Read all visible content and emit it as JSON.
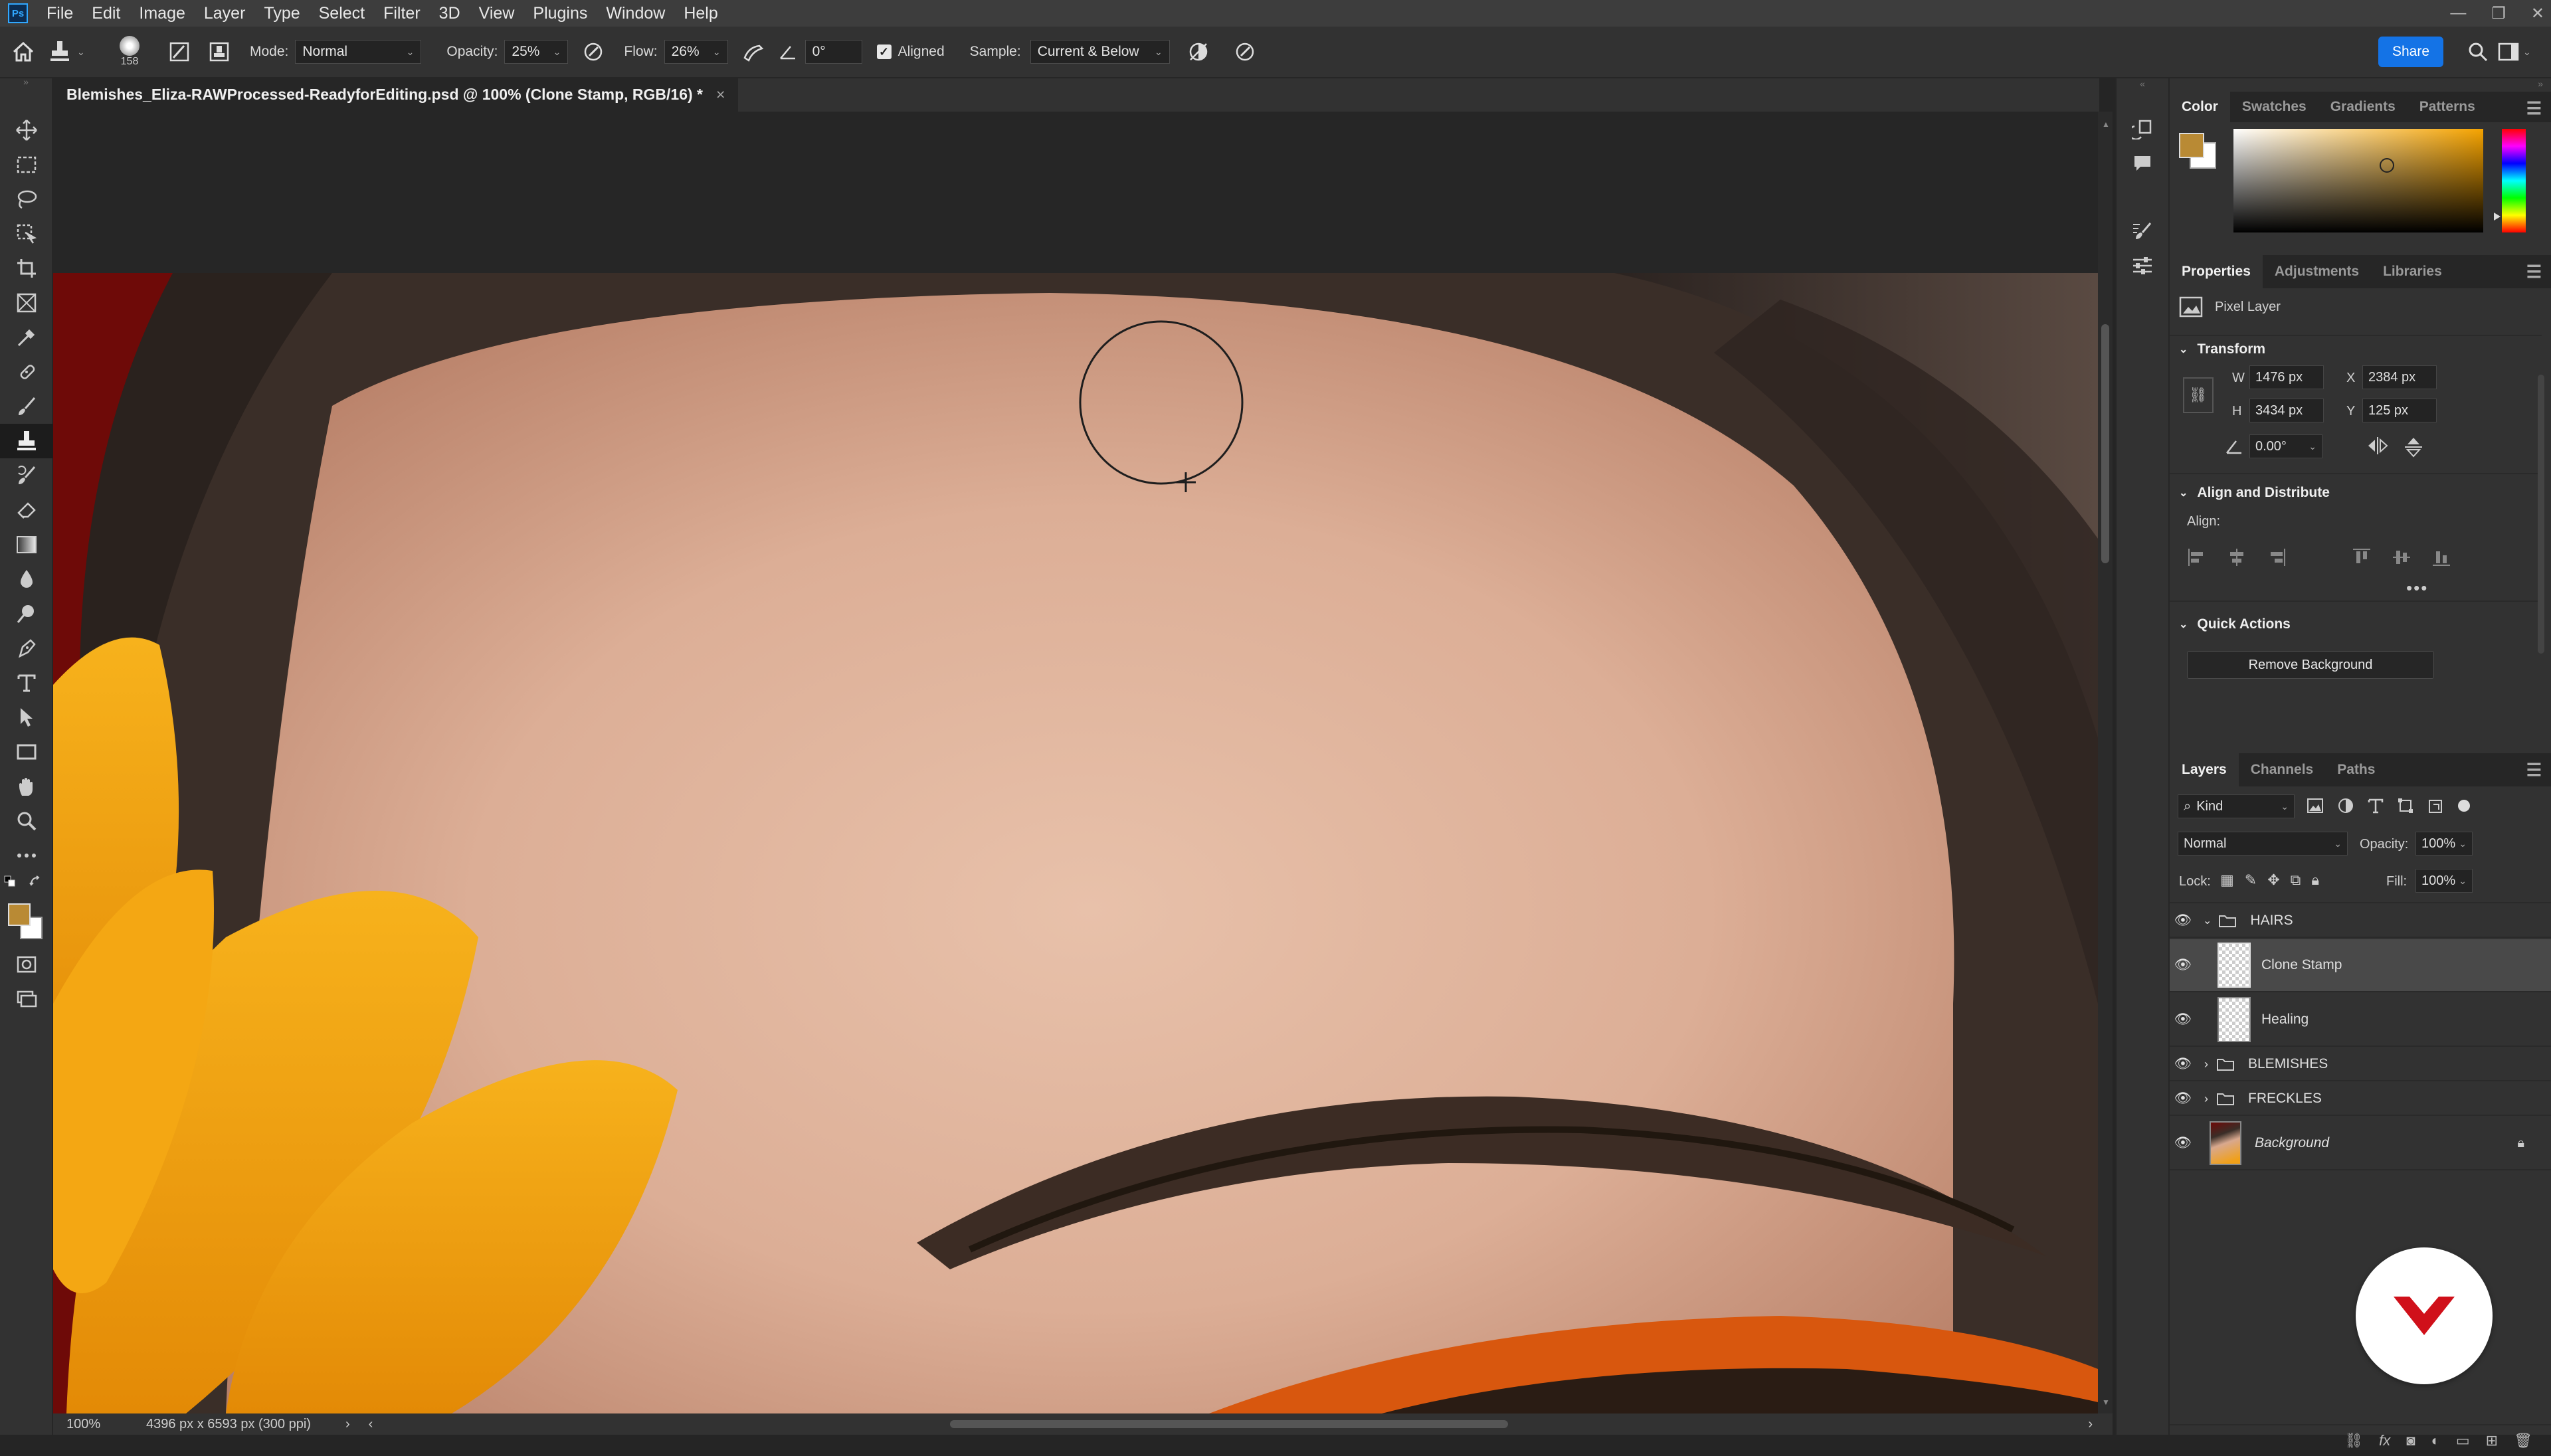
{
  "menubar": {
    "app_icon": "Ps",
    "items": [
      "File",
      "Edit",
      "Image",
      "Layer",
      "Type",
      "Select",
      "Filter",
      "3D",
      "View",
      "Plugins",
      "Window",
      "Help"
    ],
    "window_controls": [
      "minimize-icon",
      "restore-icon",
      "close-icon"
    ]
  },
  "options": {
    "brush_size": "158",
    "mode_label": "Mode:",
    "mode_value": "Normal",
    "opacity_label": "Opacity:",
    "opacity_value": "25%",
    "flow_label": "Flow:",
    "flow_value": "26%",
    "angle_value": "0°",
    "aligned_label": "Aligned",
    "aligned_checked": true,
    "sample_label": "Sample:",
    "sample_value": "Current & Below",
    "share_label": "Share"
  },
  "document": {
    "tab_title": "Blemishes_Eliza-RAWProcessed-ReadyforEditing.psd @ 100% (Clone Stamp, RGB/16) *",
    "zoom": "100%",
    "doc_info": "4396 px x 6593 px (300 ppi)"
  },
  "color_panel": {
    "tabs": [
      "Color",
      "Swatches",
      "Gradients",
      "Patterns"
    ],
    "active_tab": "Color",
    "foreground": "#b98a34",
    "background": "#ffffff",
    "picker_hue": "#f5a300"
  },
  "properties_panel": {
    "tabs": [
      "Properties",
      "Adjustments",
      "Libraries"
    ],
    "active_tab": "Properties",
    "layer_type": "Pixel Layer",
    "transform_title": "Transform",
    "w_label": "W",
    "w_value": "1476 px",
    "h_label": "H",
    "h_value": "3434 px",
    "x_label": "X",
    "x_value": "2384 px",
    "y_label": "Y",
    "y_value": "125 px",
    "angle_value": "0.00°",
    "align_title": "Align and Distribute",
    "align_label": "Align:",
    "quick_actions_title": "Quick Actions",
    "remove_bg_label": "Remove Background"
  },
  "layers_panel": {
    "tabs": [
      "Layers",
      "Channels",
      "Paths"
    ],
    "active_tab": "Layers",
    "filter_kind": "Kind",
    "blend_mode": "Normal",
    "opacity_label": "Opacity:",
    "opacity_value": "100%",
    "lock_label": "Lock:",
    "fill_label": "Fill:",
    "fill_value": "100%",
    "layers": [
      {
        "name": "HAIRS",
        "type": "group",
        "expanded": true
      },
      {
        "name": "Clone Stamp",
        "type": "pixel",
        "selected": true
      },
      {
        "name": "Healing",
        "type": "pixel"
      },
      {
        "name": "BLEMISHES",
        "type": "group",
        "expanded": false
      },
      {
        "name": "FRECKLES",
        "type": "group",
        "expanded": false
      },
      {
        "name": "Background",
        "type": "background",
        "locked": true
      }
    ]
  },
  "colors": {
    "accent": "#1473e6",
    "chrome_dark": "#262626",
    "chrome": "#323232"
  }
}
